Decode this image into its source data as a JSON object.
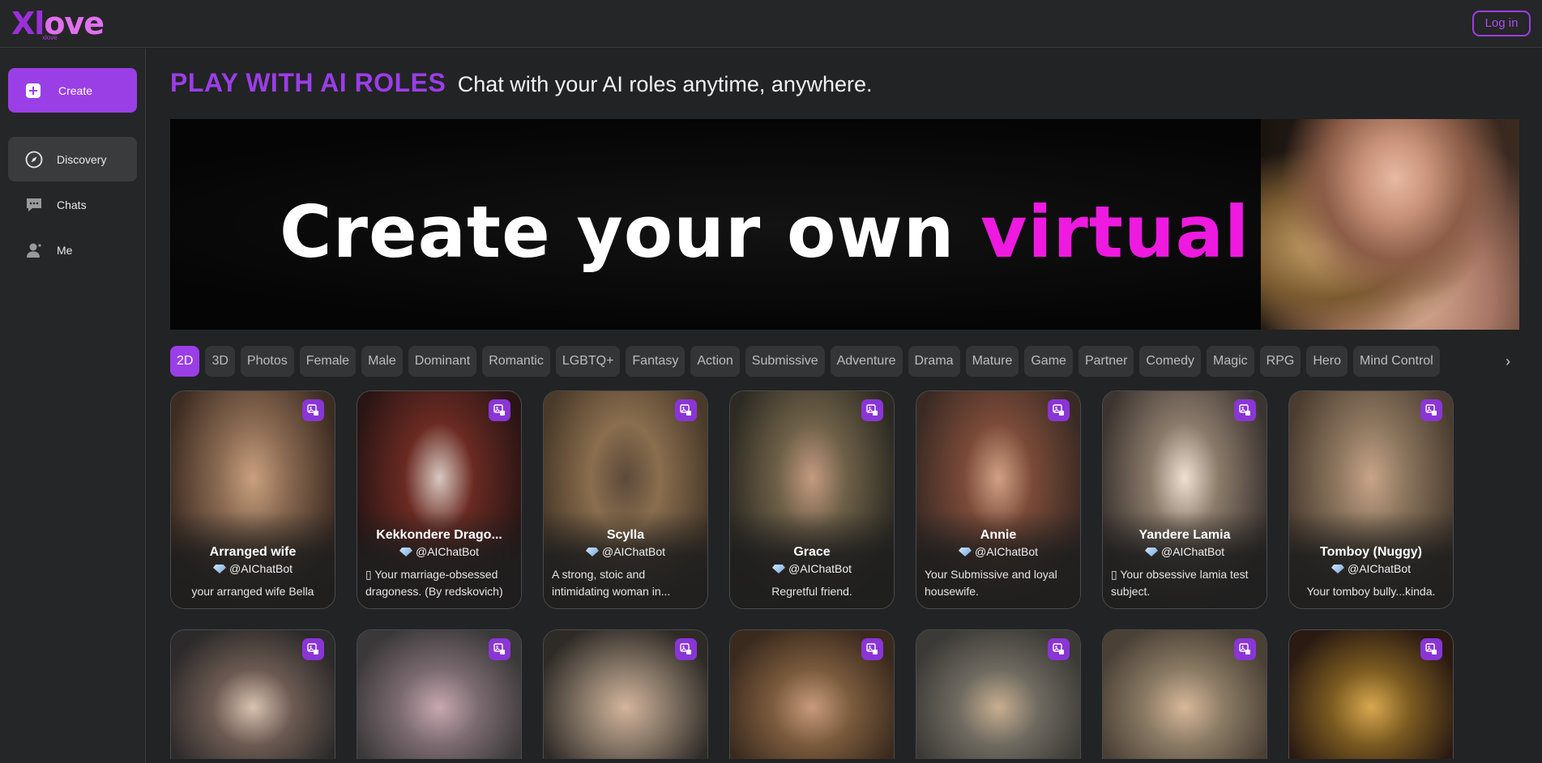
{
  "header": {
    "logo_main": "Xlove",
    "logo_sub": "xlove",
    "login_label": "Log in"
  },
  "sidebar": {
    "create_label": "Create",
    "items": [
      {
        "label": "Discovery",
        "icon": "compass-icon",
        "active": true
      },
      {
        "label": "Chats",
        "icon": "chat-bubble-icon",
        "active": false
      },
      {
        "label": "Me",
        "icon": "person-icon",
        "active": false
      }
    ]
  },
  "main": {
    "title": "PLAY WITH AI ROLES",
    "subtitle": "Chat with your AI roles anytime, anywhere.",
    "banner": {
      "text_white": "Create your own",
      "text_accent": "virtual lover"
    },
    "tags": [
      "2D",
      "3D",
      "Photos",
      "Female",
      "Male",
      "Dominant",
      "Romantic",
      "LGBTQ+",
      "Fantasy",
      "Action",
      "Submissive",
      "Adventure",
      "Drama",
      "Mature",
      "Game",
      "Partner",
      "Comedy",
      "Magic",
      "RPG",
      "Hero",
      "Mind Control"
    ],
    "active_tag": "2D",
    "cards": [
      {
        "name": "Arranged wife",
        "author": "@AIChatBot",
        "desc": "your arranged wife Bella"
      },
      {
        "name": "Kekkondere Drago...",
        "author": "@AIChatBot",
        "desc": "▯ Your marriage-obsessed dragoness. (By redskovich)"
      },
      {
        "name": "Scylla",
        "author": "@AIChatBot",
        "desc": "A strong, stoic and intimidating woman in..."
      },
      {
        "name": "Grace",
        "author": "@AIChatBot",
        "desc": "Regretful friend."
      },
      {
        "name": "Annie",
        "author": "@AIChatBot",
        "desc": "Your Submissive and loyal housewife."
      },
      {
        "name": "Yandere Lamia",
        "author": "@AIChatBot",
        "desc": "▯ Your obsessive lamia test subject."
      },
      {
        "name": "Tomboy (Nuggy)",
        "author": "@AIChatBot",
        "desc": "Your tomboy bully...kinda."
      }
    ]
  },
  "colors": {
    "accent": "#9a3ee8",
    "banner_accent": "#ee1adf",
    "background": "#222324"
  }
}
